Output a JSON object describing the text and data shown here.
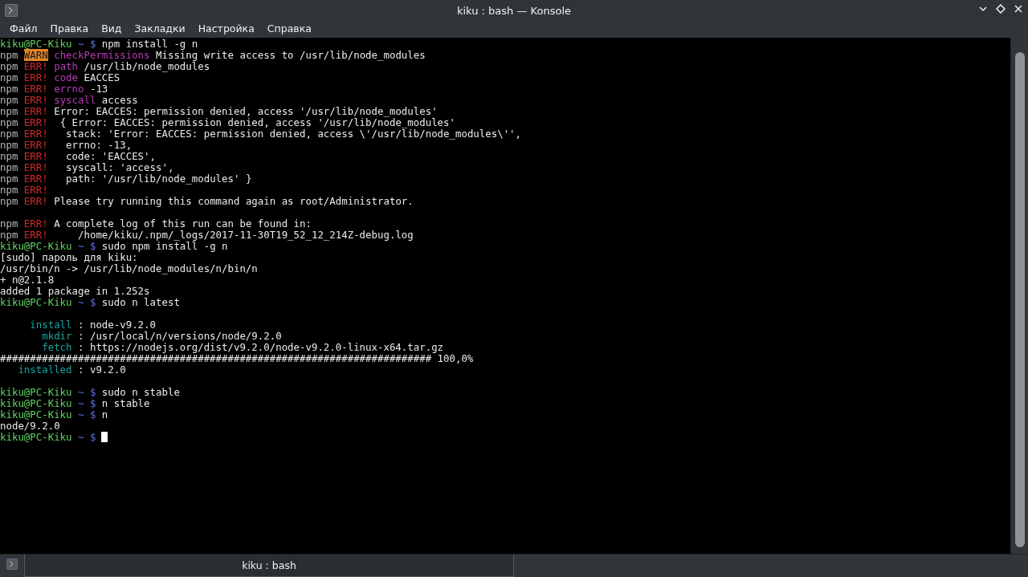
{
  "window": {
    "title": "kiku : bash — Konsole"
  },
  "menu": [
    "Файл",
    "Правка",
    "Вид",
    "Закладки",
    "Настройка",
    "Справка"
  ],
  "terminal": {
    "lines": [
      {
        "kind": "text",
        "segments": [
          {
            "text": "kiku@PC-Kiku",
            "kind": "user"
          },
          {
            "text": "~ $",
            "kind": "path"
          },
          {
            "text": "npm install -g n",
            "kind": "text"
          }
        ]
      },
      {
        "kind": "text",
        "segments": [
          {
            "text": "npm",
            "kind": "npm"
          },
          {
            "text": "WARN",
            "kind": "warn"
          },
          {
            "text": "checkPermissions",
            "kind": "key"
          },
          {
            "text": "Missing write access to /usr/lib/node_modules",
            "kind": "text"
          }
        ]
      },
      {
        "kind": "text",
        "segments": [
          {
            "text": "npm",
            "kind": "npm"
          },
          {
            "text": "ERR!",
            "kind": "err"
          },
          {
            "text": "path",
            "kind": "key"
          },
          {
            "text": "/usr/lib/node_modules",
            "kind": "text"
          }
        ]
      },
      {
        "kind": "text",
        "segments": [
          {
            "text": "npm",
            "kind": "npm"
          },
          {
            "text": "ERR!",
            "kind": "err"
          },
          {
            "text": "code",
            "kind": "key"
          },
          {
            "text": "EACCES",
            "kind": "text"
          }
        ]
      },
      {
        "kind": "text",
        "segments": [
          {
            "text": "npm",
            "kind": "npm"
          },
          {
            "text": "ERR!",
            "kind": "err"
          },
          {
            "text": "errno",
            "kind": "key"
          },
          {
            "text": "-13",
            "kind": "text"
          }
        ]
      },
      {
        "kind": "text",
        "segments": [
          {
            "text": "npm",
            "kind": "npm"
          },
          {
            "text": "ERR!",
            "kind": "err"
          },
          {
            "text": "syscall",
            "kind": "key"
          },
          {
            "text": "access",
            "kind": "text"
          }
        ]
      },
      {
        "kind": "text",
        "segments": [
          {
            "text": "npm",
            "kind": "npm"
          },
          {
            "text": "ERR!",
            "kind": "err"
          },
          {
            "text": "Error: EACCES: permission denied, access '/usr/lib/node_modules'",
            "kind": "text"
          }
        ]
      },
      {
        "kind": "text",
        "segments": [
          {
            "text": "npm",
            "kind": "npm"
          },
          {
            "text": "ERR!",
            "kind": "err"
          },
          {
            "text": " { Error: EACCES: permission denied, access '/usr/lib/node_modules'",
            "kind": "text"
          }
        ]
      },
      {
        "kind": "text",
        "segments": [
          {
            "text": "npm",
            "kind": "npm"
          },
          {
            "text": "ERR!",
            "kind": "err"
          },
          {
            "text": "  stack: 'Error: EACCES: permission denied, access \\'/usr/lib/node_modules\\'',",
            "kind": "text"
          }
        ]
      },
      {
        "kind": "text",
        "segments": [
          {
            "text": "npm",
            "kind": "npm"
          },
          {
            "text": "ERR!",
            "kind": "err"
          },
          {
            "text": "  errno: -13,",
            "kind": "text"
          }
        ]
      },
      {
        "kind": "text",
        "segments": [
          {
            "text": "npm",
            "kind": "npm"
          },
          {
            "text": "ERR!",
            "kind": "err"
          },
          {
            "text": "  code: 'EACCES',",
            "kind": "text"
          }
        ]
      },
      {
        "kind": "text",
        "segments": [
          {
            "text": "npm",
            "kind": "npm"
          },
          {
            "text": "ERR!",
            "kind": "err"
          },
          {
            "text": "  syscall: 'access',",
            "kind": "text"
          }
        ]
      },
      {
        "kind": "text",
        "segments": [
          {
            "text": "npm",
            "kind": "npm"
          },
          {
            "text": "ERR!",
            "kind": "err"
          },
          {
            "text": "  path: '/usr/lib/node_modules' }",
            "kind": "text"
          }
        ]
      },
      {
        "kind": "text",
        "segments": [
          {
            "text": "npm",
            "kind": "npm"
          },
          {
            "text": "ERR!",
            "kind": "err"
          }
        ]
      },
      {
        "kind": "text",
        "segments": [
          {
            "text": "npm",
            "kind": "npm"
          },
          {
            "text": "ERR!",
            "kind": "err"
          },
          {
            "text": "Please try running this command again as root/Administrator.",
            "kind": "text"
          }
        ]
      },
      {
        "kind": "blank"
      },
      {
        "kind": "text",
        "segments": [
          {
            "text": "npm",
            "kind": "npm"
          },
          {
            "text": "ERR!",
            "kind": "err"
          },
          {
            "text": "A complete log of this run can be found in:",
            "kind": "text"
          }
        ]
      },
      {
        "kind": "text",
        "segments": [
          {
            "text": "npm",
            "kind": "npm"
          },
          {
            "text": "ERR!",
            "kind": "err"
          },
          {
            "text": "    /home/kiku/.npm/_logs/2017-11-30T19_52_12_214Z-debug.log",
            "kind": "text"
          }
        ]
      },
      {
        "kind": "text",
        "segments": [
          {
            "text": "kiku@PC-Kiku",
            "kind": "user"
          },
          {
            "text": "~ $",
            "kind": "path"
          },
          {
            "text": "sudo npm install -g n",
            "kind": "text"
          }
        ]
      },
      {
        "kind": "text",
        "segments": [
          {
            "text": "[sudo] пароль для kiku:",
            "kind": "text"
          }
        ]
      },
      {
        "kind": "text",
        "segments": [
          {
            "text": "/usr/bin/n -> /usr/lib/node_modules/n/bin/n",
            "kind": "text"
          }
        ]
      },
      {
        "kind": "text",
        "segments": [
          {
            "text": "+ n@2.1.8",
            "kind": "text"
          }
        ]
      },
      {
        "kind": "text",
        "segments": [
          {
            "text": "added 1 package in 1.252s",
            "kind": "text"
          }
        ]
      },
      {
        "kind": "text",
        "segments": [
          {
            "text": "kiku@PC-Kiku",
            "kind": "user"
          },
          {
            "text": "~ $",
            "kind": "path"
          },
          {
            "text": "sudo n latest",
            "kind": "text"
          }
        ]
      },
      {
        "kind": "blank"
      },
      {
        "kind": "text",
        "segments": [
          {
            "text": "     install",
            "kind": "info"
          },
          {
            "text": ": node-v9.2.0",
            "kind": "text"
          }
        ]
      },
      {
        "kind": "text",
        "segments": [
          {
            "text": "       mkdir",
            "kind": "info"
          },
          {
            "text": ": /usr/local/n/versions/node/9.2.0",
            "kind": "text"
          }
        ]
      },
      {
        "kind": "text",
        "segments": [
          {
            "text": "       fetch",
            "kind": "info"
          },
          {
            "text": ": https://nodejs.org/dist/v9.2.0/node-v9.2.0-linux-x64.tar.gz",
            "kind": "text"
          }
        ]
      },
      {
        "kind": "text",
        "segments": [
          {
            "text": "######################################################################## 100,0%",
            "kind": "text"
          }
        ]
      },
      {
        "kind": "text",
        "segments": [
          {
            "text": "   installed",
            "kind": "info"
          },
          {
            "text": ": v9.2.0",
            "kind": "text"
          }
        ]
      },
      {
        "kind": "blank"
      },
      {
        "kind": "text",
        "segments": [
          {
            "text": "kiku@PC-Kiku",
            "kind": "user"
          },
          {
            "text": "~ $",
            "kind": "path"
          },
          {
            "text": "sudo n stable",
            "kind": "text"
          }
        ]
      },
      {
        "kind": "text",
        "segments": [
          {
            "text": "kiku@PC-Kiku",
            "kind": "user"
          },
          {
            "text": "~ $",
            "kind": "path"
          },
          {
            "text": "n stable",
            "kind": "text"
          }
        ]
      },
      {
        "kind": "text",
        "segments": [
          {
            "text": "kiku@PC-Kiku",
            "kind": "user"
          },
          {
            "text": "~ $",
            "kind": "path"
          },
          {
            "text": "n",
            "kind": "text"
          }
        ]
      },
      {
        "kind": "text",
        "segments": [
          {
            "text": "node/9.2.0",
            "kind": "text"
          }
        ]
      },
      {
        "kind": "text",
        "cursor": true,
        "segments": [
          {
            "text": "kiku@PC-Kiku",
            "kind": "user"
          },
          {
            "text": "~ $",
            "kind": "path"
          }
        ]
      }
    ]
  },
  "tabs": [
    {
      "label": "kiku : bash",
      "selected": true
    }
  ]
}
